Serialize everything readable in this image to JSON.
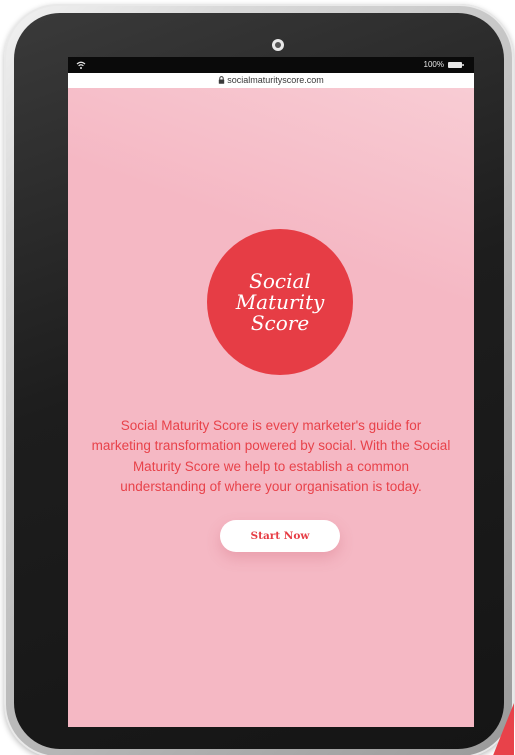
{
  "status_bar": {
    "battery_text": "100%",
    "wifi_icon": "wifi-icon",
    "battery_icon": "battery-icon"
  },
  "address_bar": {
    "url": "socialmaturityscore.com",
    "lock_icon": "lock-icon"
  },
  "hero": {
    "logo_lines": [
      "Social",
      "Maturity",
      "Score"
    ],
    "description": "Social Maturity Score is every marketer's guide for marketing transformation powered by social. With the Social Maturity Score we help to establish a common understanding of where your organisation is today.",
    "cta_label": "Start Now"
  },
  "colors": {
    "page_background": "#f5b8c4",
    "accent": "#e63d45",
    "text_accent": "#e8424a",
    "device_bezel": "#1d1d1d"
  }
}
